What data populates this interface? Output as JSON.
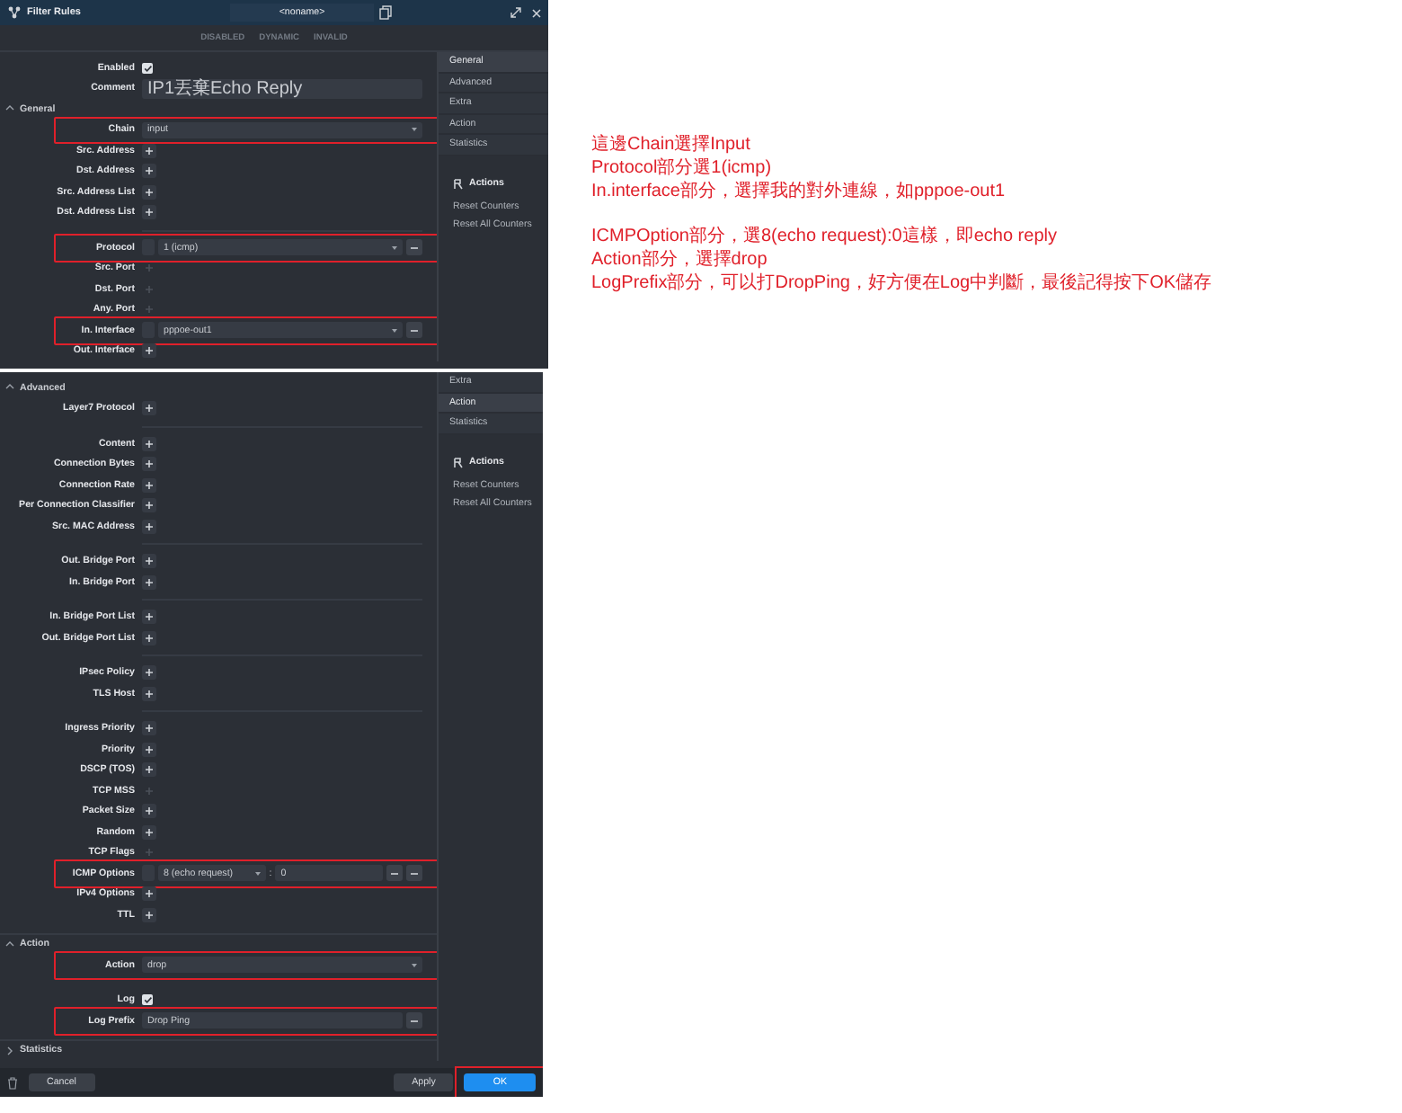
{
  "window": {
    "title": "Filter Rules",
    "name": "<noname>",
    "flags": [
      {
        "label": "DISABLED",
        "active": false
      },
      {
        "label": "DYNAMIC",
        "active": false
      },
      {
        "label": "INVALID",
        "active": false
      }
    ]
  },
  "panes": [
    {
      "sidebar": {
        "tabs": [
          {
            "label": "General",
            "selected": true
          },
          {
            "label": "Advanced",
            "selected": false
          },
          {
            "label": "Extra",
            "selected": false
          },
          {
            "label": "Action",
            "selected": false
          },
          {
            "label": "Statistics",
            "selected": false
          }
        ],
        "actions_title": "Actions",
        "actions": [
          "Reset Counters",
          "Reset All Counters"
        ]
      },
      "top_rows": [
        {
          "kind": "checkbox",
          "label": "Enabled",
          "checked": true,
          "highlighted": false
        },
        {
          "kind": "input",
          "label": "Comment",
          "value": "IP1丟棄Echo Reply",
          "removable": false,
          "highlighted": false
        }
      ],
      "sections": [
        {
          "title": "General",
          "expanded": true,
          "rows": [
            {
              "kind": "select",
              "label": "Chain",
              "value": "input",
              "negate_box": false,
              "removable": false,
              "highlighted": true
            },
            {
              "kind": "add",
              "label": "Src. Address",
              "disabled": false,
              "highlighted": false
            },
            {
              "kind": "add",
              "label": "Dst. Address",
              "disabled": false,
              "highlighted": false
            },
            {
              "kind": "add",
              "label": "Src. Address List",
              "disabled": false,
              "highlighted": false
            },
            {
              "kind": "add",
              "label": "Dst. Address List",
              "disabled": false,
              "highlighted": false
            },
            {
              "kind": "divider"
            },
            {
              "kind": "select",
              "label": "Protocol",
              "value": "1 (icmp)",
              "negate_box": true,
              "removable": true,
              "highlighted": true
            },
            {
              "kind": "add",
              "label": "Src. Port",
              "disabled": true,
              "highlighted": false
            },
            {
              "kind": "add",
              "label": "Dst. Port",
              "disabled": true,
              "highlighted": false
            },
            {
              "kind": "add",
              "label": "Any. Port",
              "disabled": true,
              "highlighted": false
            },
            {
              "kind": "select",
              "label": "In. Interface",
              "value": "pppoe-out1",
              "negate_box": true,
              "removable": true,
              "highlighted": true
            },
            {
              "kind": "add",
              "label": "Out. Interface",
              "disabled": false,
              "highlighted": false
            }
          ]
        }
      ]
    },
    {
      "sidebar": {
        "tabs": [
          {
            "label": "Extra",
            "selected": false
          },
          {
            "label": "Action",
            "selected": true
          },
          {
            "label": "Statistics",
            "selected": false
          }
        ],
        "actions_title": "Actions",
        "actions": [
          "Reset Counters",
          "Reset All Counters"
        ]
      },
      "sections": [
        {
          "title": "Advanced",
          "expanded": true,
          "rows": [
            {
              "kind": "add",
              "label": "Layer7 Protocol",
              "disabled": false,
              "highlighted": false
            },
            {
              "kind": "divider"
            },
            {
              "kind": "add",
              "label": "Content",
              "disabled": false,
              "highlighted": false
            },
            {
              "kind": "add",
              "label": "Connection Bytes",
              "disabled": false,
              "highlighted": false
            },
            {
              "kind": "add",
              "label": "Connection Rate",
              "disabled": false,
              "highlighted": false
            },
            {
              "kind": "add",
              "label": "Per Connection Classifier",
              "disabled": false,
              "highlighted": false
            },
            {
              "kind": "add",
              "label": "Src. MAC Address",
              "disabled": false,
              "highlighted": false
            },
            {
              "kind": "divider"
            },
            {
              "kind": "add",
              "label": "Out. Bridge Port",
              "disabled": false,
              "highlighted": false
            },
            {
              "kind": "add",
              "label": "In. Bridge Port",
              "disabled": false,
              "highlighted": false
            },
            {
              "kind": "divider"
            },
            {
              "kind": "add",
              "label": "In. Bridge Port List",
              "disabled": false,
              "highlighted": false
            },
            {
              "kind": "add",
              "label": "Out. Bridge Port List",
              "disabled": false,
              "highlighted": false
            },
            {
              "kind": "divider"
            },
            {
              "kind": "add",
              "label": "IPsec Policy",
              "disabled": false,
              "highlighted": false
            },
            {
              "kind": "add",
              "label": "TLS Host",
              "disabled": false,
              "highlighted": false
            },
            {
              "kind": "divider"
            },
            {
              "kind": "add",
              "label": "Ingress Priority",
              "disabled": false,
              "highlighted": false
            },
            {
              "kind": "add",
              "label": "Priority",
              "disabled": false,
              "highlighted": false
            },
            {
              "kind": "add",
              "label": "DSCP (TOS)",
              "disabled": false,
              "highlighted": false
            },
            {
              "kind": "add",
              "label": "TCP MSS",
              "disabled": true,
              "highlighted": false
            },
            {
              "kind": "add",
              "label": "Packet Size",
              "disabled": false,
              "highlighted": false
            },
            {
              "kind": "add",
              "label": "Random",
              "disabled": false,
              "highlighted": false
            },
            {
              "kind": "add",
              "label": "TCP Flags",
              "disabled": true,
              "highlighted": false
            },
            {
              "kind": "icmp",
              "label": "ICMP Options",
              "type_value": "8 (echo request)",
              "separator": ":",
              "code_value": "0",
              "highlighted": true
            },
            {
              "kind": "add",
              "label": "IPv4 Options",
              "disabled": false,
              "highlighted": false
            },
            {
              "kind": "add",
              "label": "TTL",
              "disabled": false,
              "highlighted": false
            }
          ]
        },
        {
          "title": "Action",
          "expanded": true,
          "rows": [
            {
              "kind": "select",
              "label": "Action",
              "value": "drop",
              "negate_box": false,
              "removable": false,
              "highlighted": true
            },
            {
              "kind": "spacer"
            },
            {
              "kind": "checkbox",
              "label": "Log",
              "checked": true,
              "highlighted": false
            },
            {
              "kind": "input",
              "label": "Log Prefix",
              "value": "Drop Ping",
              "removable": true,
              "highlighted": true
            }
          ]
        },
        {
          "title": "Statistics",
          "expanded": false
        }
      ],
      "footer": {
        "buttons": [
          {
            "label": "Cancel",
            "primary": false,
            "highlighted": false
          },
          {
            "label": "Apply",
            "primary": false,
            "highlighted": false
          },
          {
            "label": "OK",
            "primary": true,
            "highlighted": true
          }
        ]
      }
    }
  ],
  "notes": [
    [
      "這邊Chain選擇Input",
      "Protocol部分選1(icmp)",
      "In.interface部分，選擇我的對外連線，如pppoe-out1"
    ],
    [
      "ICMPOption部分，選8(echo request):0這樣，即echo reply",
      "Action部分，選擇drop",
      "LogPrefix部分，可以打DropPing，好方便在Log中判斷，最後記得按下OK儲存"
    ]
  ]
}
